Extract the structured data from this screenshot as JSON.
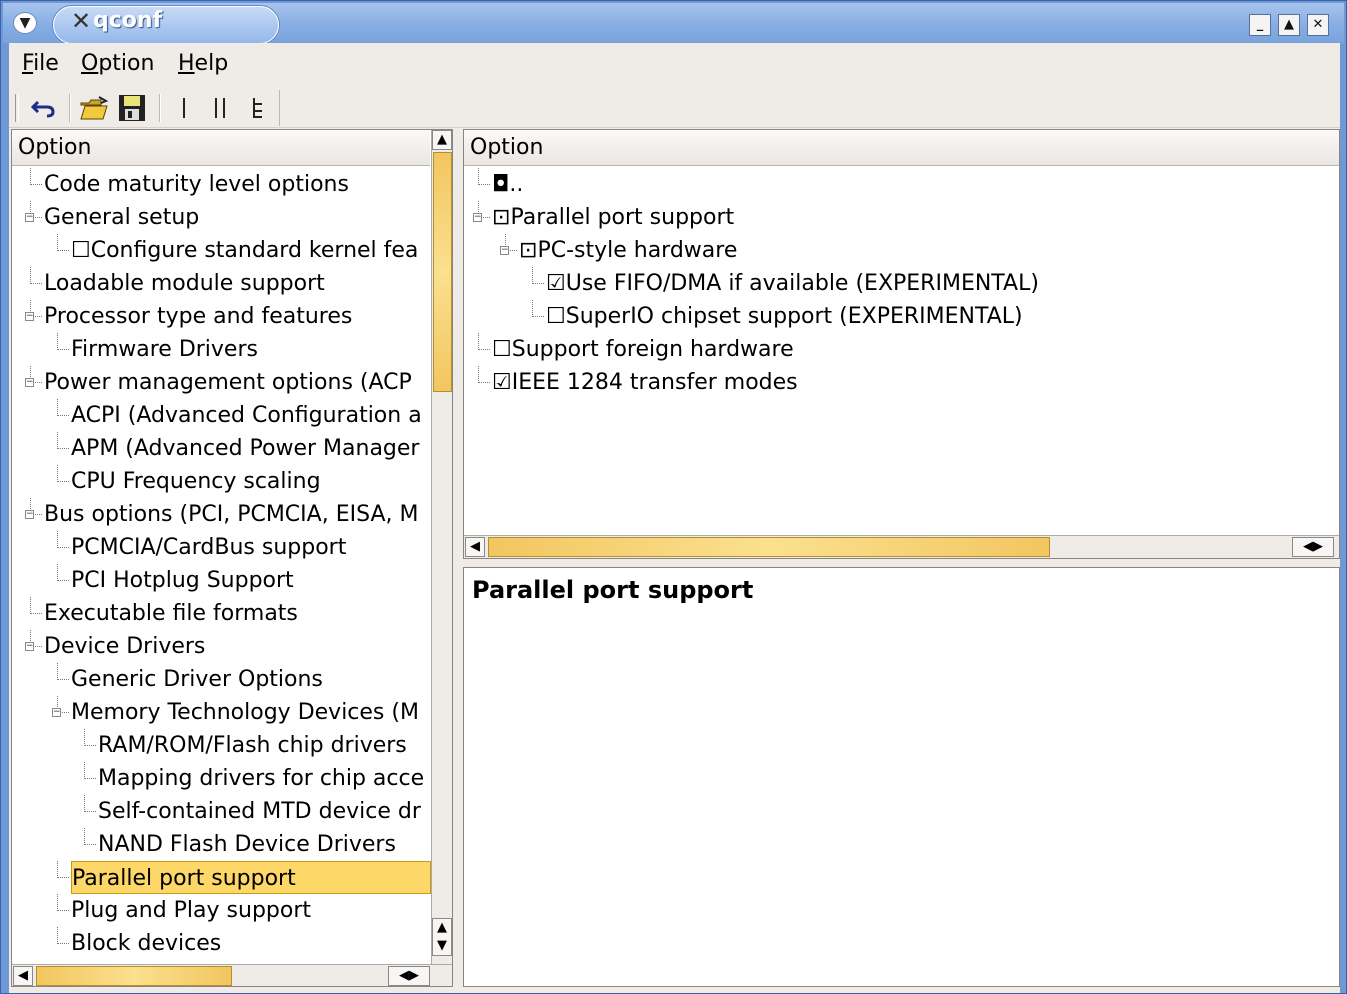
{
  "window": {
    "title": "qconf",
    "menu_icon": "chevron-down-icon",
    "controls": [
      "minimize-icon",
      "maximize-icon",
      "close-icon"
    ]
  },
  "menubar": {
    "file": {
      "mnemonic": "F",
      "rest": "ile"
    },
    "option": {
      "mnemonic": "O",
      "rest": "ption"
    },
    "help": {
      "mnemonic": "H",
      "rest": "elp"
    }
  },
  "toolbar": {
    "buttons": [
      "back-icon",
      "open-icon",
      "save-icon",
      "single-view-icon",
      "split-view-icon",
      "full-view-icon"
    ]
  },
  "left_tree": {
    "header": "Option",
    "items": [
      {
        "label": "Code maturity level options",
        "depth": 0
      },
      {
        "label": "General setup",
        "depth": 0,
        "expanded": true
      },
      {
        "label": "☐Configure standard kernel fea",
        "depth": 1
      },
      {
        "label": "Loadable module support",
        "depth": 0
      },
      {
        "label": "Processor type and features",
        "depth": 0,
        "expanded": true
      },
      {
        "label": "Firmware Drivers",
        "depth": 1
      },
      {
        "label": "Power management options (ACP",
        "depth": 0,
        "expanded": true
      },
      {
        "label": "ACPI (Advanced Configuration a",
        "depth": 1
      },
      {
        "label": "APM (Advanced Power Manager",
        "depth": 1
      },
      {
        "label": "CPU Frequency scaling",
        "depth": 1
      },
      {
        "label": "Bus options (PCI, PCMCIA, EISA, M",
        "depth": 0,
        "expanded": true
      },
      {
        "label": "PCMCIA/CardBus support",
        "depth": 1
      },
      {
        "label": "PCI Hotplug Support",
        "depth": 1
      },
      {
        "label": "Executable file formats",
        "depth": 0
      },
      {
        "label": "Device Drivers",
        "depth": 0,
        "expanded": true
      },
      {
        "label": "Generic Driver Options",
        "depth": 1
      },
      {
        "label": "Memory Technology Devices (M",
        "depth": 1,
        "expanded": true
      },
      {
        "label": "RAM/ROM/Flash chip drivers",
        "depth": 2
      },
      {
        "label": "Mapping drivers for chip acce",
        "depth": 2
      },
      {
        "label": "Self-contained MTD device dr",
        "depth": 2
      },
      {
        "label": "NAND Flash Device Drivers",
        "depth": 2
      },
      {
        "label": "Parallel port support",
        "depth": 1,
        "selected": true
      },
      {
        "label": "Plug and Play support",
        "depth": 1
      },
      {
        "label": "Block devices",
        "depth": 1
      }
    ]
  },
  "right_tree": {
    "header": "Option",
    "items": [
      {
        "label": "..",
        "box": "◘",
        "depth": 0
      },
      {
        "label": "Parallel port support",
        "box": "⊡",
        "depth": 0,
        "expanded": true
      },
      {
        "label": "PC-style hardware",
        "box": "⊡",
        "depth": 1,
        "expanded": true
      },
      {
        "label": "Use FIFO/DMA if available (EXPERIMENTAL)",
        "box": "☑",
        "depth": 2
      },
      {
        "label": "SuperIO chipset support (EXPERIMENTAL)",
        "box": "☐",
        "depth": 2
      },
      {
        "label": "Support foreign hardware",
        "box": "☐",
        "depth": 0
      },
      {
        "label": "IEEE 1284 transfer modes",
        "box": "☑",
        "depth": 0
      }
    ]
  },
  "info": {
    "title": "Parallel port support"
  },
  "colors": {
    "selection": "#fdd767",
    "scroll_thumb": "#f2c660",
    "title_bar": "#87aee4",
    "chrome": "#efebe7"
  }
}
